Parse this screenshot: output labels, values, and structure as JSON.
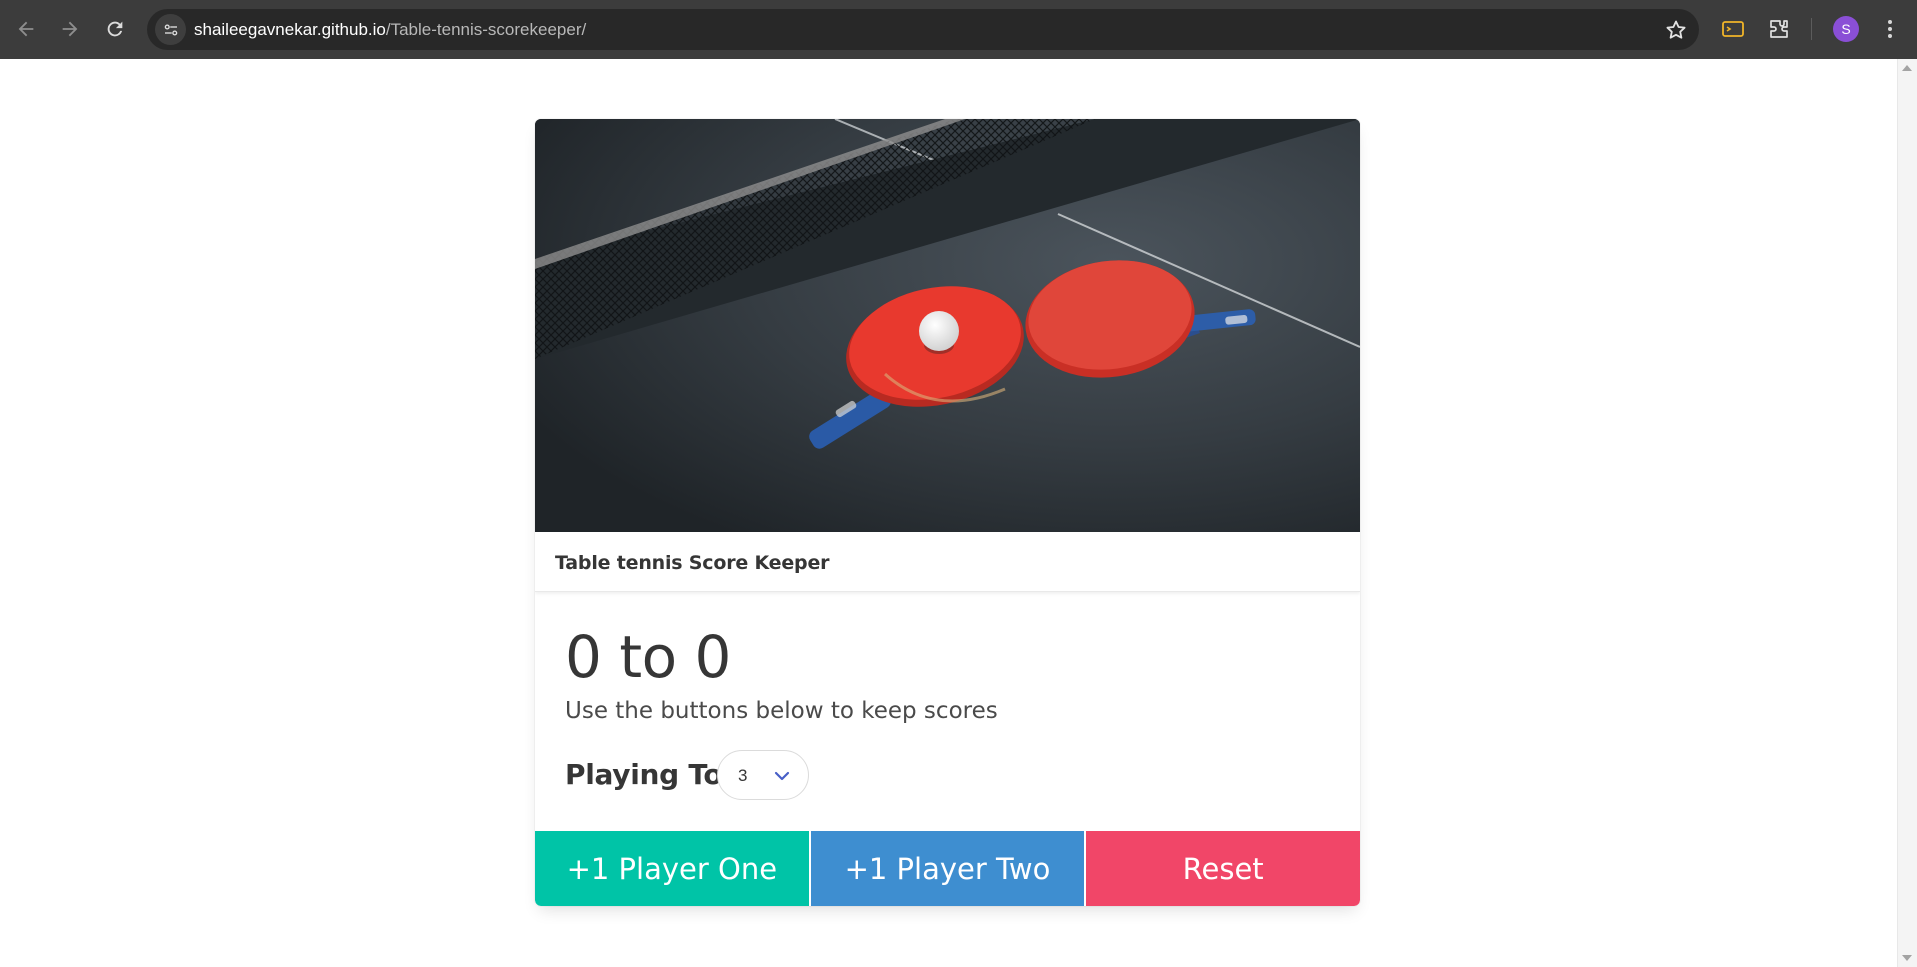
{
  "browser": {
    "url_host": "shaileegavnekar.github.io",
    "url_path": "/Table-tennis-scorekeeper/",
    "profile_initial": "S",
    "icons": [
      "back-arrow-icon",
      "forward-arrow-icon",
      "reload-icon",
      "site-info-icon",
      "bookmark-star-icon",
      "cast-icon",
      "extensions-icon",
      "more-vert-icon"
    ]
  },
  "card": {
    "image_alt": "Two red table tennis paddles and a white ball on a dark table next to the net",
    "header_title": "Table tennis Score Keeper",
    "score_display": "0 to 0",
    "subtitle": "Use the buttons below to keep scores",
    "playing_to_label": "Playing To",
    "playing_to_value": "3"
  },
  "buttons": {
    "player_one": "+1 Player One",
    "player_two": "+1 Player Two",
    "reset": "Reset"
  },
  "colors": {
    "player_one": "#00c4a7",
    "player_two": "#3e8ed0",
    "reset": "#f14668",
    "chrome_bg": "#3c3c3c",
    "avatar": "#8a4fd6"
  }
}
